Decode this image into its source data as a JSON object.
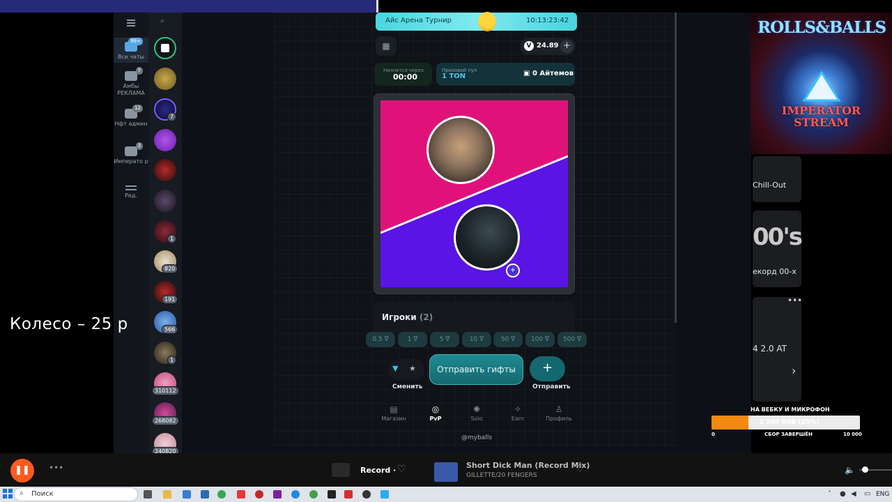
{
  "telegram": {
    "folders": [
      {
        "label": "Все чаты",
        "badge": "99+",
        "active": true
      },
      {
        "label": "Амбы РЕКЛАМА",
        "badge": "7"
      },
      {
        "label": "Нфт админ",
        "badge": "12"
      },
      {
        "label": "Императо р",
        "badge": "3"
      },
      {
        "label": "Ред."
      }
    ],
    "chat_badges": [
      "7",
      "1",
      "820",
      "191",
      "566",
      "1",
      "310112",
      "268082",
      "240820"
    ]
  },
  "app": {
    "banner_title": "Айс Арена Турнир",
    "banner_time": "10:13:23:42",
    "balance": "24.89",
    "start_label": "Начнется через",
    "start_value": "00:00",
    "pool_label": "Призовой пул",
    "pool_value": "1 TON",
    "pool_items": "0 Айтемов",
    "players_label": "Игроки",
    "players_count": "(2)",
    "chips": [
      "0.5",
      "1",
      "5",
      "10",
      "50",
      "100",
      "500"
    ],
    "switch_label": "Сменить",
    "send_gifts": "Отправить гифты",
    "plus_label": "Отправить",
    "nav": [
      {
        "label": "Магазин",
        "icon": "shop-icon"
      },
      {
        "label": "PvP",
        "icon": "pvp-icon",
        "active": true
      },
      {
        "label": "Solo",
        "icon": "solo-icon"
      },
      {
        "label": "Earn",
        "icon": "earn-icon"
      },
      {
        "label": "Профиль",
        "icon": "profile-icon"
      }
    ],
    "footer": "@myballs"
  },
  "overlay": {
    "wheel_text": "Колесо – 25 р",
    "stream_title_1": "ROLLS&BALLS",
    "stream_title_2": "IMPERATOR STREAM",
    "right_items": {
      "chill": "Chill-Out",
      "oos": "00's",
      "record": "екорд 00-х",
      "ats": "4 2.0 AT"
    },
    "goal": {
      "title": "НА ВЕБКУ И МИКРОФОН",
      "value_text": "2 500 RUB (25%)",
      "progress": 0.25,
      "min": "0",
      "status": "СБОР ЗАВЕРШЁН",
      "max": "10 000"
    }
  },
  "player": {
    "record_label": "Record ·",
    "song": "Short Dick Man (Record Mix)",
    "artist": "GILLETTE/20 FENGERS"
  },
  "taskbar": {
    "search_placeholder": "Поиск",
    "lang": "ENG"
  },
  "colors": {
    "arena_pink": "#e0127a",
    "arena_purple": "#5a14e6",
    "accent_teal": "#14686f",
    "goal_orange": "#f28a12"
  }
}
